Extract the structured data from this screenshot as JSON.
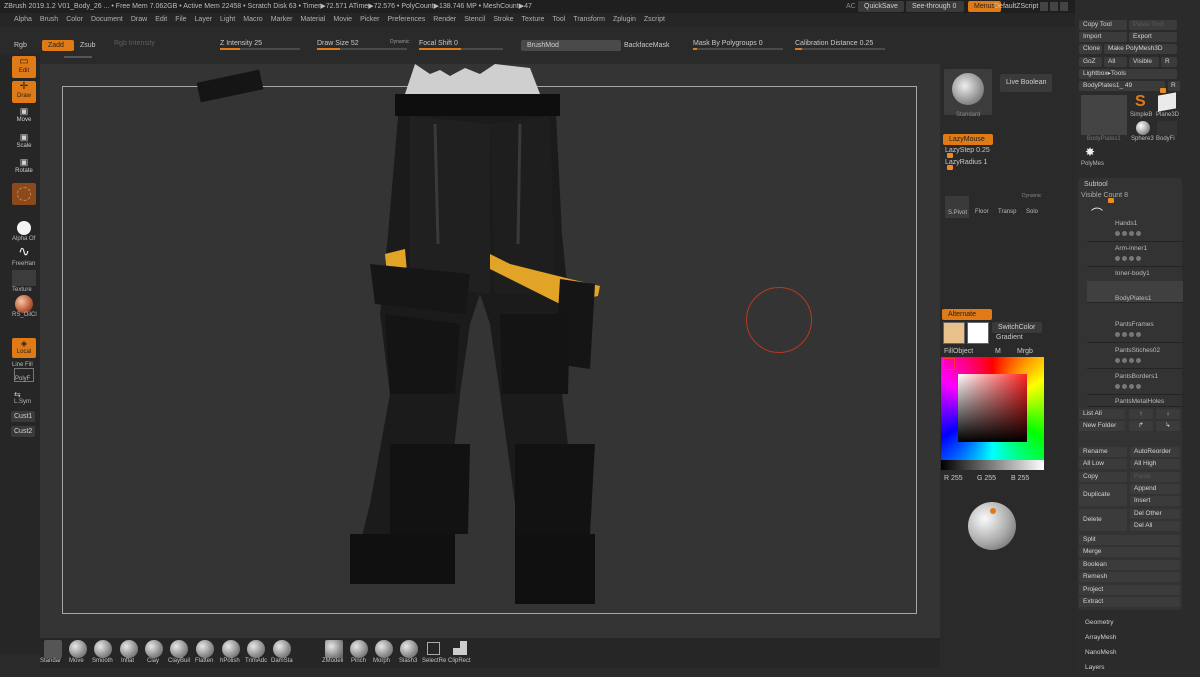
{
  "title": "ZBrush 2019.1.2   V01_Body_26   ... • Free Mem 7.062GB • Active Mem 22458 • Scratch Disk 63 • Timer▶72.571 ATime▶72.576 • PolyCount▶138.746 MP • MeshCount▶47",
  "title_ac": "AC",
  "title_btns": {
    "quicksave": "QuickSave",
    "seethrough": "See-through",
    "seethrough_val": "0",
    "menus": "Menus",
    "defaultzscript": "DefaultZScript"
  },
  "menus": [
    "Alpha",
    "Brush",
    "Color",
    "Document",
    "Draw",
    "Edit",
    "File",
    "Layer",
    "Light",
    "Macro",
    "Marker",
    "Material",
    "Movie",
    "Picker",
    "Preferences",
    "Render",
    "Stencil",
    "Stroke",
    "Texture",
    "Tool",
    "Transform",
    "Zplugin",
    "Zscript"
  ],
  "toolbar": {
    "rgb": "Rgb",
    "rgb_intensity": "Rgb Intensity",
    "zadd": "Zadd",
    "zsub": "Zsub",
    "z_intensity": "Z Intensity 25",
    "draw_size": "Draw Size 52",
    "dynamic": "Dynamic",
    "focal_shift": "Focal Shift 0",
    "brushmod": "BrushMod",
    "backface": "BackfaceMask",
    "mask_polygroups": "Mask By Polygroups 0",
    "calibration": "Calibration Distance 0.25"
  },
  "left": {
    "edit": "Edit",
    "draw": "Draw",
    "move": "Move",
    "scale": "Scale",
    "rotate": "Rotate",
    "alpha": "Alpha Of",
    "freehand": "FreeHan",
    "texture": "Texture",
    "material": "RS_OilCl",
    "local": "Local",
    "line_fill": "Line Fill",
    "polyf": "PolyF",
    "lsym": "L.Sym",
    "cust1": "Cust1",
    "cust2": "Cust2"
  },
  "bottom": {
    "brushes": [
      "Standar",
      "Move",
      "Smooth",
      "Inflat",
      "Clay",
      "ClayBuil",
      "Flatten",
      "hPolish",
      "TrimAdc",
      "DamSta"
    ],
    "tools": [
      "ZModeli",
      "Pinch",
      "Morph",
      "Slash3",
      "SelectRe",
      "ClipRect"
    ]
  },
  "mid": {
    "standard": "Standard",
    "live_boolean": "Live Boolean",
    "lazymouse": "LazyMouse",
    "lazystep": "LazyStep 0.25",
    "lazyradius": "LazyRadius 1",
    "spivot": "S.Pivot",
    "floor": "Floor",
    "transp": "Transp",
    "dynamic": "Dynamic",
    "solo": "Solo",
    "alternate": "Alternate",
    "switchcolor": "SwitchColor",
    "gradient": "Gradient",
    "fillobject": "FillObject",
    "m": "M",
    "mrgb": "Mrgb",
    "r": "R 255",
    "g": "G 255",
    "b": "B 255"
  },
  "right": {
    "copy_tool": "Copy Tool",
    "paste_tool": "Paste Tool",
    "import": "Import",
    "export": "Export",
    "clone": "Clone",
    "make_polymesh": "Make PolyMesh3D",
    "goz": "GoZ",
    "all": "All",
    "visible": "Visible",
    "r": "R",
    "lightbox": "Lightbox▸Tools",
    "current": "BodyPlates1_ 49",
    "current_r": "R",
    "simpleb": "SimpleB",
    "plane3d": "Plane3D",
    "bodyplates1": "BodyPlates1",
    "sphere3": "Sphere3",
    "bodyfi": "BodyFi",
    "polymesh": "PolyMes",
    "subtool": "Subtool",
    "visible_count": "Visible Count 8",
    "subtools": [
      "Hands1",
      "Arm-inner1",
      "Inner-body1",
      "BodyPlates1",
      "PantsFrames",
      "PantsStiches02",
      "PantsBorders1",
      "PantsMetalHoles"
    ],
    "list_all": "List All",
    "new_folder": "New Folder",
    "rename": "Rename",
    "autoreorder": "AutoReorder",
    "all_low": "All Low",
    "all_high": "All High",
    "copy": "Copy",
    "paste": "Paste",
    "append": "Append",
    "duplicate": "Duplicate",
    "insert": "Insert",
    "del_other": "Del Other",
    "delete": "Delete",
    "del_all": "Del All",
    "split": "Split",
    "merge": "Merge",
    "boolean": "Boolean",
    "remesh": "Remesh",
    "project": "Project",
    "extract": "Extract",
    "geometry": "Geometry",
    "arraymesh": "ArrayMesh",
    "nanomesh": "NanoMesh",
    "layers": "Layers"
  },
  "colors": {
    "accent": "#e07a16",
    "primary_color": "#e9c18a",
    "secondary_color": "#ffffff"
  }
}
